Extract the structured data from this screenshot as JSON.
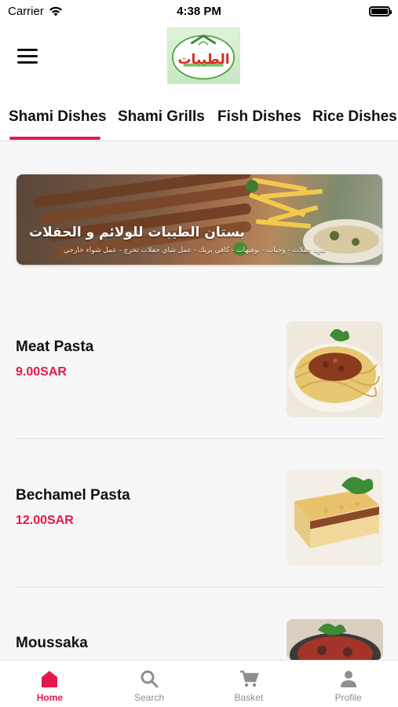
{
  "status_bar": {
    "carrier": "Carrier",
    "time": "4:38 PM"
  },
  "header": {
    "menu_icon": "hamburger-menu-icon",
    "logo_icon": "restaurant-logo",
    "logo_text": "الطيبات"
  },
  "tabs": [
    {
      "label": "Shami Dishes",
      "active": true
    },
    {
      "label": "Shami Grills",
      "active": false
    },
    {
      "label": "Fish Dishes",
      "active": false
    },
    {
      "label": "Rice Dishes",
      "active": false
    }
  ],
  "banner": {
    "title": "بستان الطيبات للولائم و الحفلات",
    "subtitle": "تعهد حفلات - وجبات - بوفيهات - كافي بريك - عمل شاي حفلات تخرج - عمل شواء خارجي"
  },
  "menu_items": [
    {
      "name": "Meat Pasta",
      "price": "9.00SAR",
      "image_icon": "meat-pasta-photo"
    },
    {
      "name": "Bechamel Pasta",
      "price": "12.00SAR",
      "image_icon": "bechamel-pasta-photo"
    },
    {
      "name": "Moussaka",
      "price": "",
      "image_icon": "moussaka-photo"
    }
  ],
  "bottom_nav": [
    {
      "label": "Home",
      "icon": "home-icon",
      "active": true
    },
    {
      "label": "Search",
      "icon": "search-icon",
      "active": false
    },
    {
      "label": "Basket",
      "icon": "cart-icon",
      "active": false
    },
    {
      "label": "Profile",
      "icon": "person-icon",
      "active": false
    }
  ],
  "colors": {
    "accent": "#e8174a",
    "inactive": "#8e8e8e",
    "background": "#f7f7f7"
  }
}
